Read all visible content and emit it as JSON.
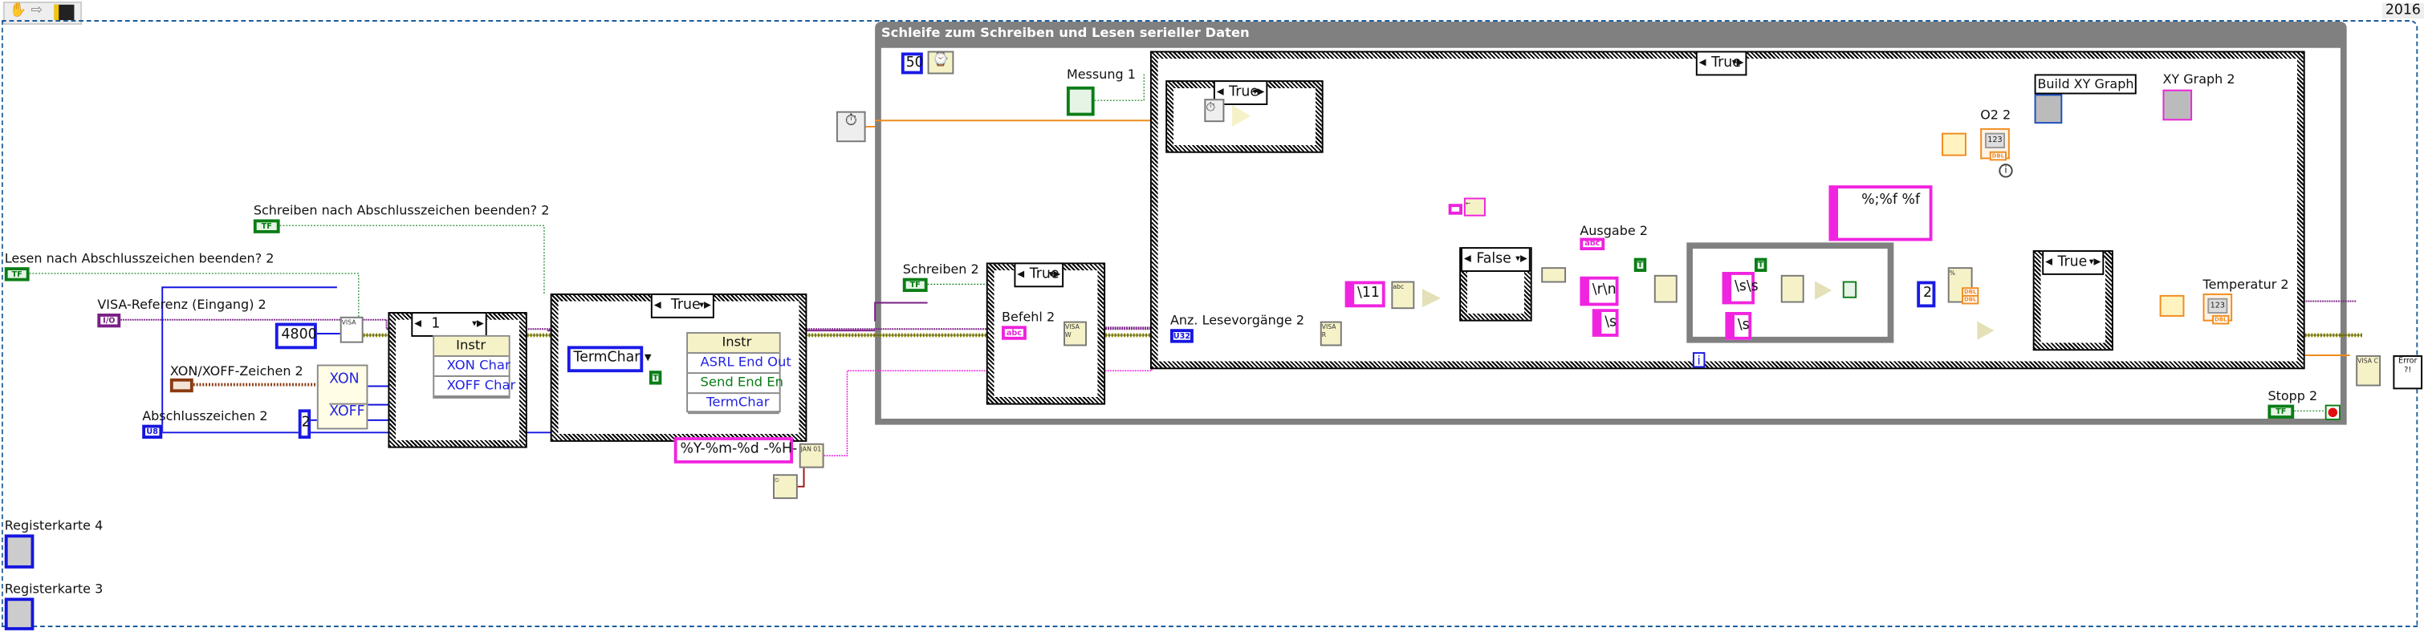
{
  "toolbar": {
    "icons": [
      "hand-icon",
      "arrow-icon",
      "highlight-execution-icon"
    ]
  },
  "version_tag": "2016",
  "loop": {
    "title": "Schleife zum Schreiben und Lesen serieller Daten",
    "wait_ms": "50",
    "iteration_terminal": "i"
  },
  "left_controls": {
    "schreiben_term": "Schreiben nach Abschlusszeichen beenden? 2",
    "lesen_term": "Lesen nach Abschlusszeichen beenden? 2",
    "visa_ref": "VISA-Referenz (Eingang) 2",
    "baud_rate": "4800",
    "xon_xoff": "XON/XOFF-Zeichen 2",
    "xon": "XON",
    "xoff": "XOFF",
    "abschlusszeichen": "Abschlusszeichen 2",
    "const_two": "2",
    "tf": "TF",
    "io": "I/O",
    "u8": "U8",
    "tab4": "Registerkarte 4",
    "tab3": "Registerkarte 3"
  },
  "case1": {
    "selector": "1",
    "node_header": "Instr",
    "rows": [
      "XON Char",
      "XOFF Char"
    ]
  },
  "case2": {
    "selector": "True",
    "node_header": "Instr",
    "rows": [
      "ASRL End Out",
      "Send End En",
      "TermChar"
    ],
    "enum_value": "TermChar",
    "true_const": "T"
  },
  "time_format": "%Y-%m-%d -%H-",
  "inside_loop": {
    "messung": "Messung 1",
    "schreiben": "Schreiben 2",
    "write_case_selector": "True",
    "befehl": "Befehl 2",
    "abc": "abc",
    "big_case_selector": "True",
    "timer_case_selector": "True",
    "anz_lese": "Anz. Lesevorgänge 2",
    "u32": "U32",
    "const_11": "\\11",
    "false_case_selector": "False",
    "ausgabe": "Ausgabe 2",
    "const_rn": "\\r\\n",
    "const_s": "\\s",
    "const_ss": "\\s\\s",
    "const_s2": "\\s",
    "true_const": "T",
    "format_string": "%;%f %f",
    "const_two": "2",
    "scan_case_selector": "True",
    "o2": "O2 2",
    "temperatur": "Temperatur 2",
    "build_xy": "Build XY Graph",
    "xy_graph": "XY Graph 2",
    "stopp": "Stopp 2",
    "dbl": "DBL",
    "num_display": "123"
  },
  "colors": {
    "boolean": "#0a7d16",
    "numeric": "#1515e0",
    "string": "#ee22dd",
    "double": "#f08a1c",
    "refnum": "#7a1f86",
    "error": "#8a8a00",
    "loop_frame": "#808080"
  }
}
